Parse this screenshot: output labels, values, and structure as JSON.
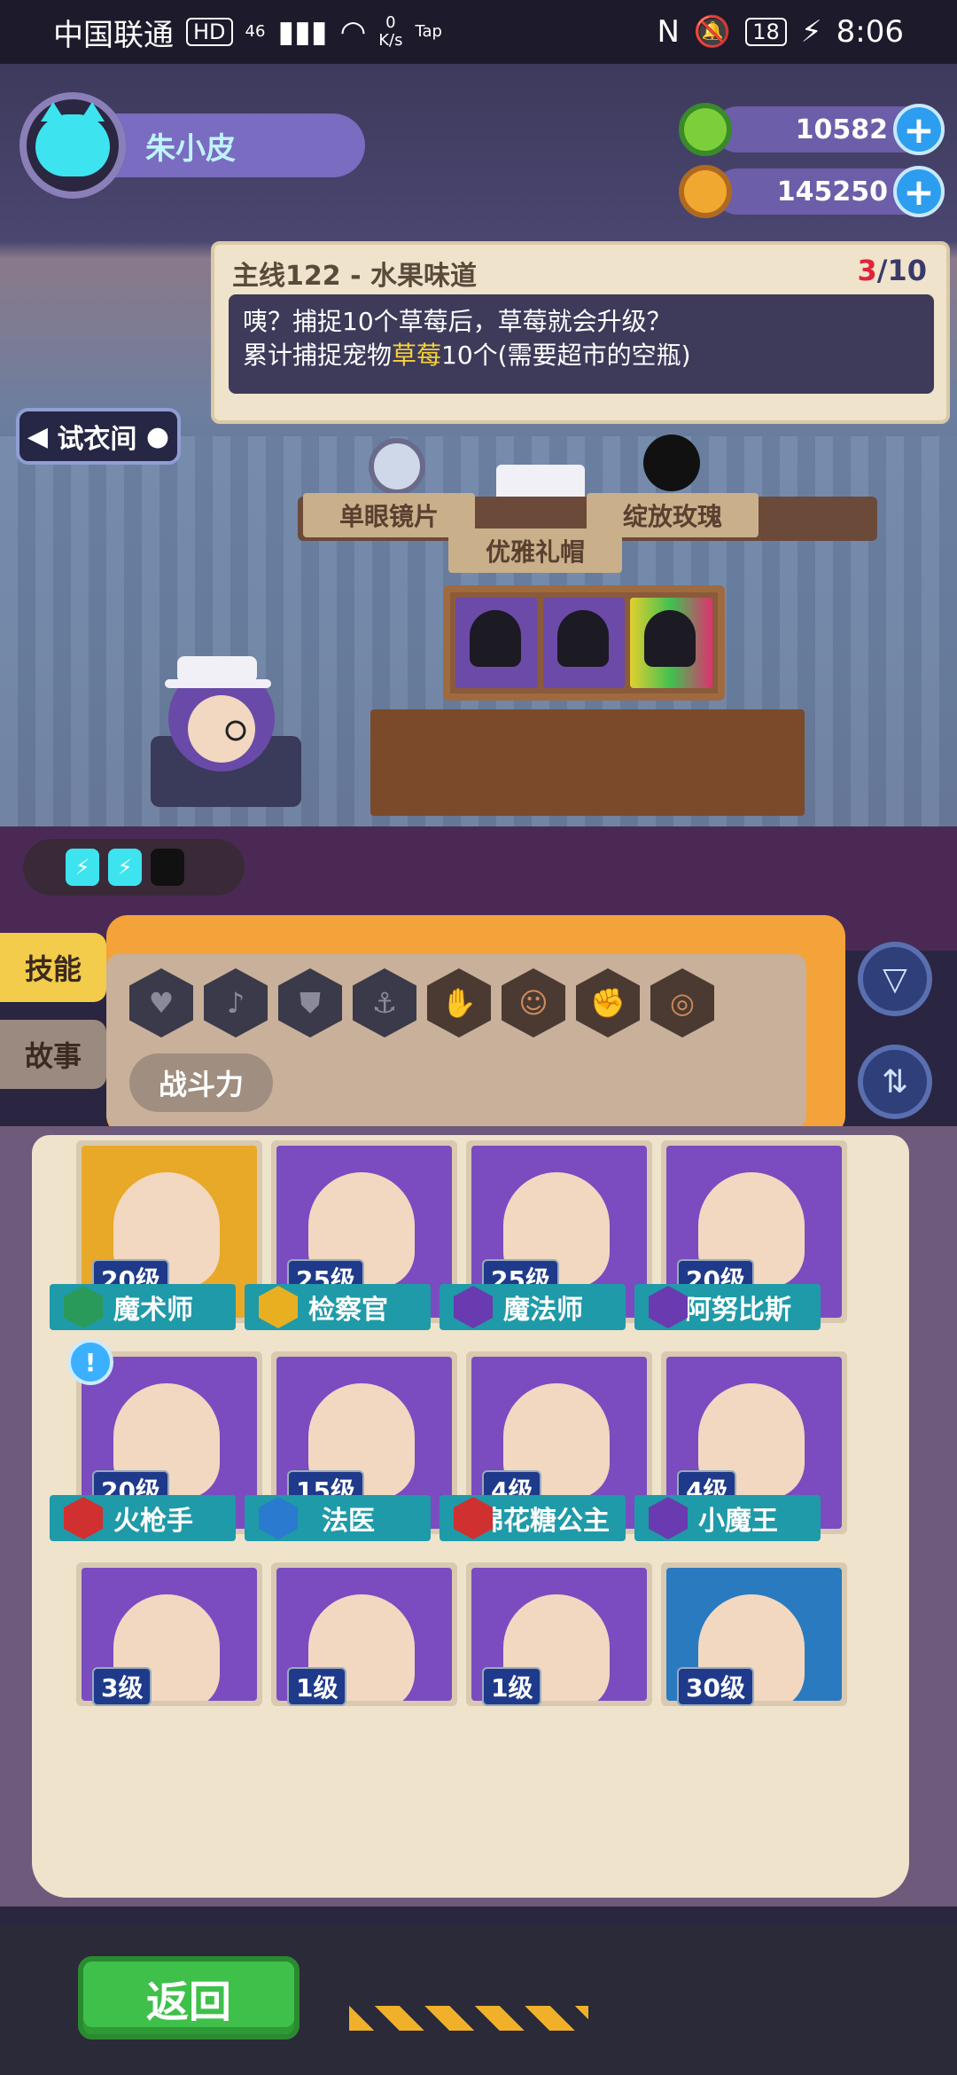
{
  "status_bar": {
    "carrier": "中国联通",
    "hd": "HD",
    "network": "46",
    "speed_value": "0",
    "speed_unit": "K/s",
    "app_label": "Tap",
    "battery": "18",
    "time": "8:06"
  },
  "player": {
    "name": "朱小皮"
  },
  "currencies": [
    {
      "name": "donut",
      "value": "10582",
      "color": "#7ccf3a"
    },
    {
      "name": "planet",
      "value": "145250",
      "color": "#f0a830"
    }
  ],
  "quest": {
    "title": "主线122 - 水果味道",
    "progress_current": "3",
    "progress_total": "/10",
    "line1": "咦？捕捉10个草莓后，草莓就会升级？",
    "line2_prefix": "累计捕捉宠物",
    "line2_highlight": "草莓",
    "line2_suffix": "10个(需要超市的空瓶)"
  },
  "wardrobe_button": "试衣间",
  "shelf_items": [
    "单眼镜片",
    "优雅礼帽",
    "绽放玫瑰"
  ],
  "tabs": {
    "skill": "技能",
    "story": "故事"
  },
  "filter_icons": [
    "heart-icon",
    "bell-icon",
    "shield-icon",
    "anchor-icon",
    "hand-icon",
    "smile-icon",
    "muscle-icon",
    "brain-icon"
  ],
  "sort_label": "战斗力",
  "characters": [
    {
      "level": "20级",
      "name": "魔术师",
      "badge_color": "#2a9a5a",
      "art": "gold"
    },
    {
      "level": "25级",
      "name": "检察官",
      "badge_color": "#e8b020",
      "art": "purple"
    },
    {
      "level": "25级",
      "name": "魔法师",
      "badge_color": "#6a3ab0",
      "art": "purple"
    },
    {
      "level": "20级",
      "name": "阿努比斯",
      "badge_color": "#6a3ab0",
      "art": "purple"
    },
    {
      "level": "20级",
      "name": "火枪手",
      "badge_color": "#d03030",
      "art": "purple"
    },
    {
      "level": "15级",
      "name": "法医",
      "badge_color": "#2a7ad0",
      "art": "purple"
    },
    {
      "level": "4级",
      "name": "棉花糖公主",
      "badge_color": "#d03030",
      "art": "purple"
    },
    {
      "level": "4级",
      "name": "小魔王",
      "badge_color": "#6a3ab0",
      "art": "purple"
    },
    {
      "level": "3级",
      "name": "",
      "art": "purple"
    },
    {
      "level": "1级",
      "name": "",
      "art": "purple"
    },
    {
      "level": "1级",
      "name": "",
      "art": "purple"
    },
    {
      "level": "30级",
      "name": "",
      "art": "purple"
    }
  ],
  "back_button": "返回"
}
